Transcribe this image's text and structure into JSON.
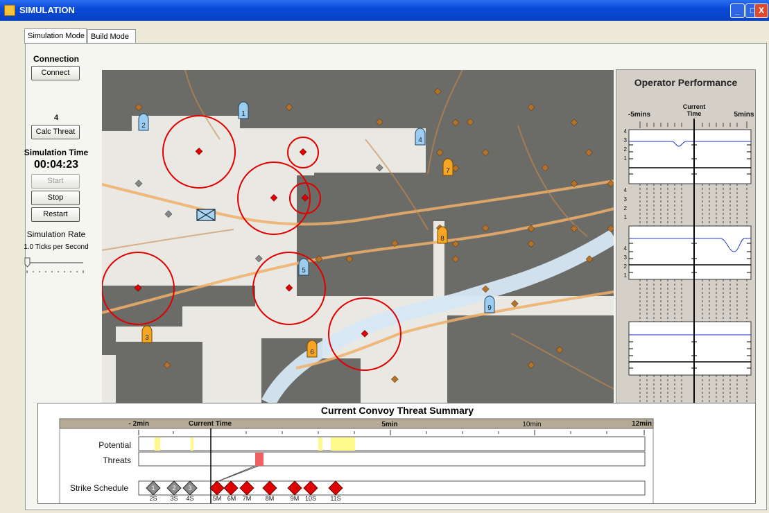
{
  "window": {
    "title": "SIMULATION",
    "controls": [
      "_",
      "□",
      "X"
    ]
  },
  "tabs": [
    {
      "label": "Simulation Mode",
      "active": true
    },
    {
      "label": "Build Mode",
      "active": false
    }
  ],
  "left": {
    "connection_label": "Connection",
    "connect_button": "Connect",
    "threat_count": "4",
    "calc_threat_button": "Calc Threat",
    "sim_time_label": "Simulation Time",
    "sim_time_value": "00:04:23",
    "start_button": "Start",
    "stop_button": "Stop",
    "restart_button": "Restart",
    "sim_rate_label": "Simulation Rate",
    "ticks_label": "1.0 Ticks per Second"
  },
  "map": {
    "uav_blue": [
      "1",
      "2",
      "4",
      "5",
      "9"
    ],
    "uav_orange": [
      "3",
      "6",
      "7",
      "8"
    ]
  },
  "performance": {
    "title": "Operator Performance",
    "minus_label": "-5mins",
    "current_label_1": "Current",
    "current_label_2": "Time",
    "plus_label": "5mins",
    "y_ticks": [
      "4",
      "3",
      "2",
      "1"
    ]
  },
  "summary": {
    "title": "Current Convoy Threat Summary",
    "timeline_labels": [
      "- 2min",
      "Current Time",
      "5min",
      "10min",
      "12min"
    ],
    "row_potential": "Potential",
    "row_threats": "Threats",
    "row_strike": "Strike Schedule",
    "strike_gray": [
      {
        "num": "1",
        "label": "2S"
      },
      {
        "num": "2",
        "label": "3S"
      },
      {
        "num": "3",
        "label": "4S"
      }
    ],
    "strike_red_labels": [
      "5M",
      "6M",
      "7M",
      "8M",
      "9M",
      "10S",
      "11S"
    ]
  },
  "colors": {
    "threat_red": "#e00000",
    "uav_blue": "#9ccdee",
    "uav_orange": "#f5a623",
    "map_dark": "#6b6b67",
    "map_light": "#e9e8e3"
  }
}
